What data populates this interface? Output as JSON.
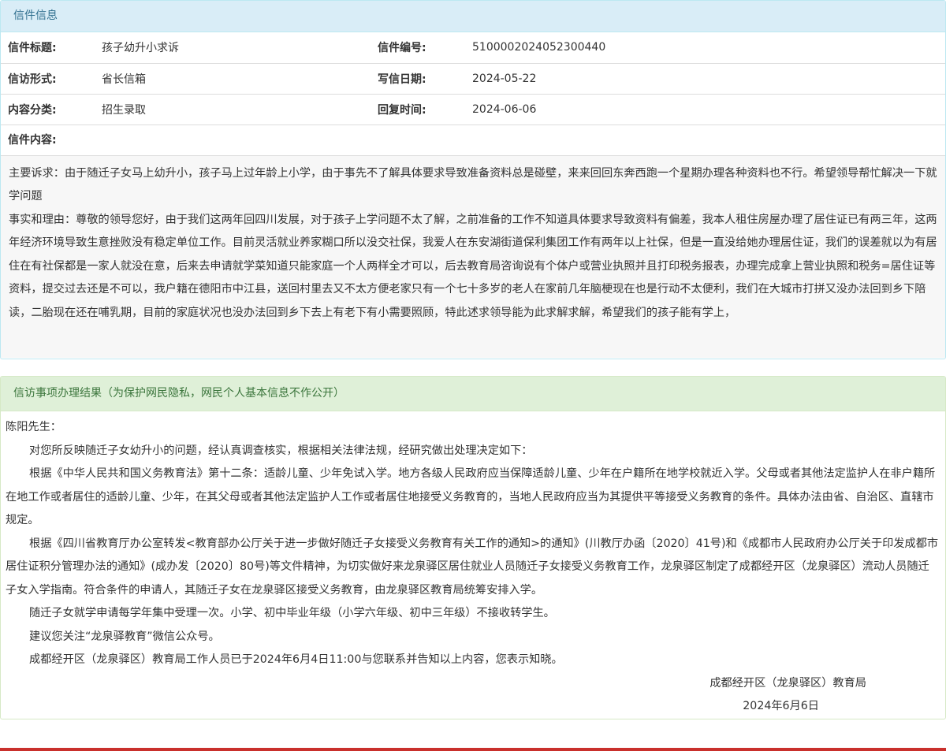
{
  "letter_panel": {
    "title": "信件信息",
    "rows": [
      {
        "label1": "信件标题:",
        "value1": "孩子幼升小求诉",
        "label2": "信件编号:",
        "value2": "5100002024052300440"
      },
      {
        "label1": "信访形式:",
        "value1": "省长信箱",
        "label2": "写信日期:",
        "value2": "2024-05-22"
      },
      {
        "label1": "内容分类:",
        "value1": "招生录取",
        "label2": "回复时间:",
        "value2": "2024-06-06"
      }
    ],
    "content_label": "信件内容:",
    "content_paragraphs": [
      "主要诉求：由于随迁子女马上幼升小，孩子马上过年龄上小学，由于事先不了解具体要求导致准备资料总是碰壁，来来回回东奔西跑一个星期办理各种资料也不行。希望领导帮忙解决一下就学问题",
      "事实和理由：尊敬的领导您好，由于我们这两年回四川发展，对于孩子上学问题不太了解，之前准备的工作不知道具体要求导致资料有偏差，我本人租住房屋办理了居住证已有两三年，这两年经济环境导致生意挫败没有稳定单位工作。目前灵活就业养家糊口所以没交社保，我爱人在东安湖街道保利集团工作有两年以上社保，但是一直没给她办理居住证，我们的误差就以为有居住在有社保都是一家人就没在意，后来去申请就学菜知道只能家庭一个人两样全才可以，后去教育局咨询说有个体户或营业执照并且打印税务报表，办理完成拿上营业执照和税务=居住证等资料，提交过去还是不可以，我户籍在德阳市中江县，送回村里去又不太方便老家只有一个七十多岁的老人在家前几年脑梗现在也是行动不太便利，我们在大城市打拼又没办法回到乡下陪读，二胎现在还在哺乳期，目前的家庭状况也没办法回到乡下去上有老下有小需要照顾，特此述求领导能为此求解求解，希望我们的孩子能有学上，"
    ]
  },
  "result_panel": {
    "title": "信访事项办理结果（为保护网民隐私，网民个人基本信息不作公开）",
    "salutation": "陈阳先生：",
    "paragraphs": [
      "对您所反映随迁子女幼升小的问题，经认真调查核实，根据相关法律法规，经研究做出处理决定如下：",
      "根据《中华人民共和国义务教育法》第十二条：适龄儿童、少年免试入学。地方各级人民政府应当保障适龄儿童、少年在户籍所在地学校就近入学。父母或者其他法定监护人在非户籍所在地工作或者居住的适龄儿童、少年，在其父母或者其他法定监护人工作或者居住地接受义务教育的，当地人民政府应当为其提供平等接受义务教育的条件。具体办法由省、自治区、直辖市规定。",
      "根据《四川省教育厅办公室转发<教育部办公厅关于进一步做好随迁子女接受义务教育有关工作的通知>的通知》(川教厅办函〔2020〕41号)和《成都市人民政府办公厅关于印发成都市居住证积分管理办法的通知》(成办发〔2020〕80号)等文件精神，为切实做好来龙泉驿区居住就业人员随迁子女接受义务教育工作，龙泉驿区制定了成都经开区（龙泉驿区）流动人员随迁子女入学指南。符合条件的申请人，其随迁子女在龙泉驿区接受义务教育，由龙泉驿区教育局统筹安排入学。",
      "随迁子女就学申请每学年集中受理一次。小学、初中毕业年级（小学六年级、初中三年级）不接收转学生。",
      "建议您关注“龙泉驿教育”微信公众号。",
      "成都经开区（龙泉驿区）教育局工作人员已于2024年6月4日11:00与您联系并告知以上内容，您表示知晓。"
    ],
    "signature_org": "成都经开区（龙泉驿区）教育局",
    "signature_date": "2024年6月6日"
  }
}
